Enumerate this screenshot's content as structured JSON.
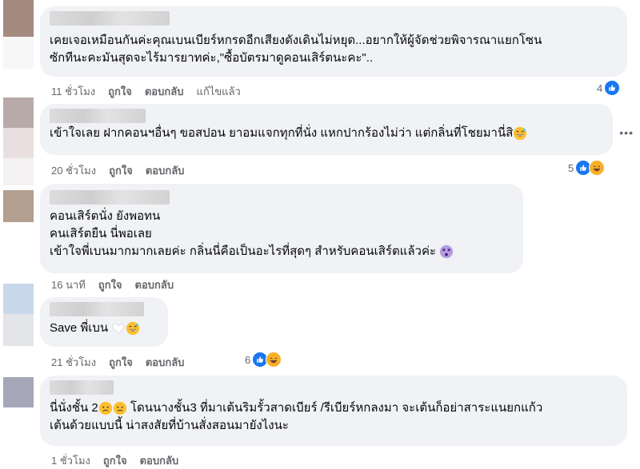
{
  "actions": {
    "like": "ถูกใจ",
    "reply": "ตอบกลับ",
    "edited": "แก้ไขแล้ว"
  },
  "comments": [
    {
      "text_lines": [
        "เคยเจอเหมือนกันค่ะคุณเบนเบียร์หกรดอีกเสียงดังเดินไม่หยุด...อยากให้ผู้จัดช่วยพิจารณาแยกโซน",
        "ซักทีนะคะมันสุดจะไร้มารยาทค่ะ,\"ซื้อบัตรมาดูคอนเสิร์ตนะคะ\".."
      ],
      "time": "11 ชั่วโมง",
      "reaction_count": "4"
    },
    {
      "text_lines": [
        "เข้าใจเลย ฝากคอนฯอื่นๆ ขอสปอน ยาอมแจกทุกที่นั่ง แหกปากร้องไม่ว่า แต่กลิ่นที่โชยมานี่สิ"
      ],
      "time": "20 ชั่วโมง",
      "reaction_count": "5"
    },
    {
      "text_lines": [
        "คอนเสิร์ตนั่ง ยังพอทน",
        "คนเสิร์ตยืน นี่พอเลย",
        "เข้าใจพี่เบนมากมากเลยค่ะ กลิ่นนี่คือเป็นอะไรที่สุดๆ สำหรับคอนเสิร์ตแล้วค่ะ"
      ],
      "time": "16 นาที"
    },
    {
      "text_lines": [
        "Save พี่เบน"
      ],
      "time": "21 ชั่วโมง",
      "reaction_count": "6"
    },
    {
      "text_lines": [
        "นี่นั่งชั้น 2",
        "โดนนางชั้น3 ที่มาเต้นริมรั้วสาดเบียร์ /รีเบียร์หกลงมา จะเต้นก็อย่าสาระแนยกแก้ว",
        "เต้นด้วยแบบนี้ น่าสงสัยที่บ้านสั่งสอนมายังไงนะ"
      ],
      "time": "1 ชั่วโมง"
    }
  ],
  "icons": {
    "like": "like-icon",
    "haha": "haha-icon",
    "grin": "grinning-sweat-emoji",
    "dizzy": "dizzy-face-emoji",
    "heart": "white-heart-emoji",
    "worried": "worried-face-emoji",
    "more": "more-options-icon"
  },
  "colors": {
    "bubble": "#f0f2f5",
    "meta": "#65676b",
    "like": "#1877f2",
    "haha": "#f7b125"
  }
}
